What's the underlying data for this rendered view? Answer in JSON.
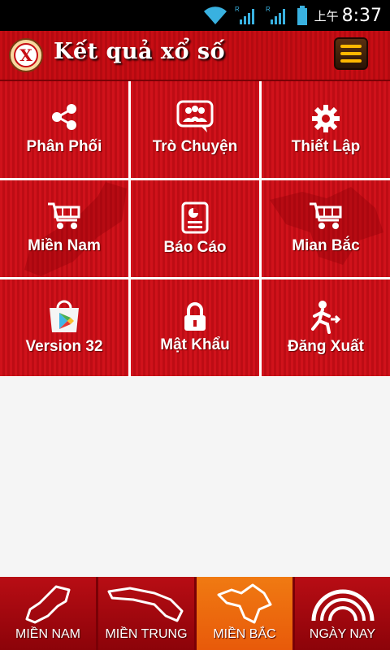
{
  "status_bar": {
    "time": "8:37",
    "ampm": "上午"
  },
  "header": {
    "title": "Kết quả xổ số",
    "logo_letter": "X"
  },
  "grid": {
    "items": [
      {
        "label": "Phân Phối",
        "icon": "share-icon"
      },
      {
        "label": "Trò Chuyện",
        "icon": "chat-icon"
      },
      {
        "label": "Thiết Lập",
        "icon": "gear-icon"
      },
      {
        "label": "Miền Nam",
        "icon": "cart-icon"
      },
      {
        "label": "Báo Cáo",
        "icon": "report-icon"
      },
      {
        "label": "Mian Bắc",
        "icon": "cart-icon"
      },
      {
        "label": "Version 32",
        "icon": "play-store-icon"
      },
      {
        "label": "Mật Khẩu",
        "icon": "lock-icon"
      },
      {
        "label": "Đăng Xuất",
        "icon": "exit-icon"
      }
    ]
  },
  "bottom_nav": {
    "items": [
      {
        "label": "MIỀN NAM",
        "icon": "south-map-icon",
        "active": false
      },
      {
        "label": "MIỀN TRUNG",
        "icon": "central-map-icon",
        "active": false
      },
      {
        "label": "MIỀN BẮC",
        "icon": "north-map-icon",
        "active": true
      },
      {
        "label": "NGÀY NAY",
        "icon": "rainbow-icon",
        "active": false
      }
    ]
  },
  "colors": {
    "accent": "#c70d14",
    "active_tab": "#f07a12",
    "menu_lines": "#ffb700"
  }
}
